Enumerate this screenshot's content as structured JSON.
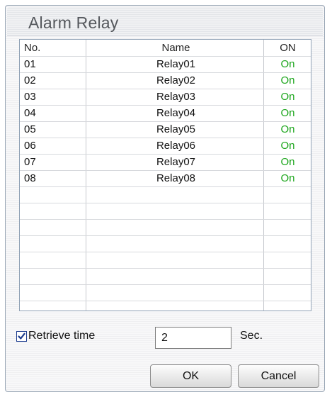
{
  "dialog": {
    "title": "Alarm Relay"
  },
  "table": {
    "headers": {
      "no": "No.",
      "name": "Name",
      "on": "ON"
    },
    "rows": [
      {
        "no": "01",
        "name": "Relay01",
        "on": "On"
      },
      {
        "no": "02",
        "name": "Relay02",
        "on": "On"
      },
      {
        "no": "03",
        "name": "Relay03",
        "on": "On"
      },
      {
        "no": "04",
        "name": "Relay04",
        "on": "On"
      },
      {
        "no": "05",
        "name": "Relay05",
        "on": "On"
      },
      {
        "no": "06",
        "name": "Relay06",
        "on": "On"
      },
      {
        "no": "07",
        "name": "Relay07",
        "on": "On"
      },
      {
        "no": "08",
        "name": "Relay08",
        "on": "On"
      }
    ],
    "on_color": "#1aa51a"
  },
  "retrieve": {
    "label": "Retrieve time",
    "checked": true,
    "value": "2",
    "unit": "Sec.",
    "check_icon": "checkmark-icon"
  },
  "buttons": {
    "ok": "OK",
    "cancel": "Cancel"
  }
}
